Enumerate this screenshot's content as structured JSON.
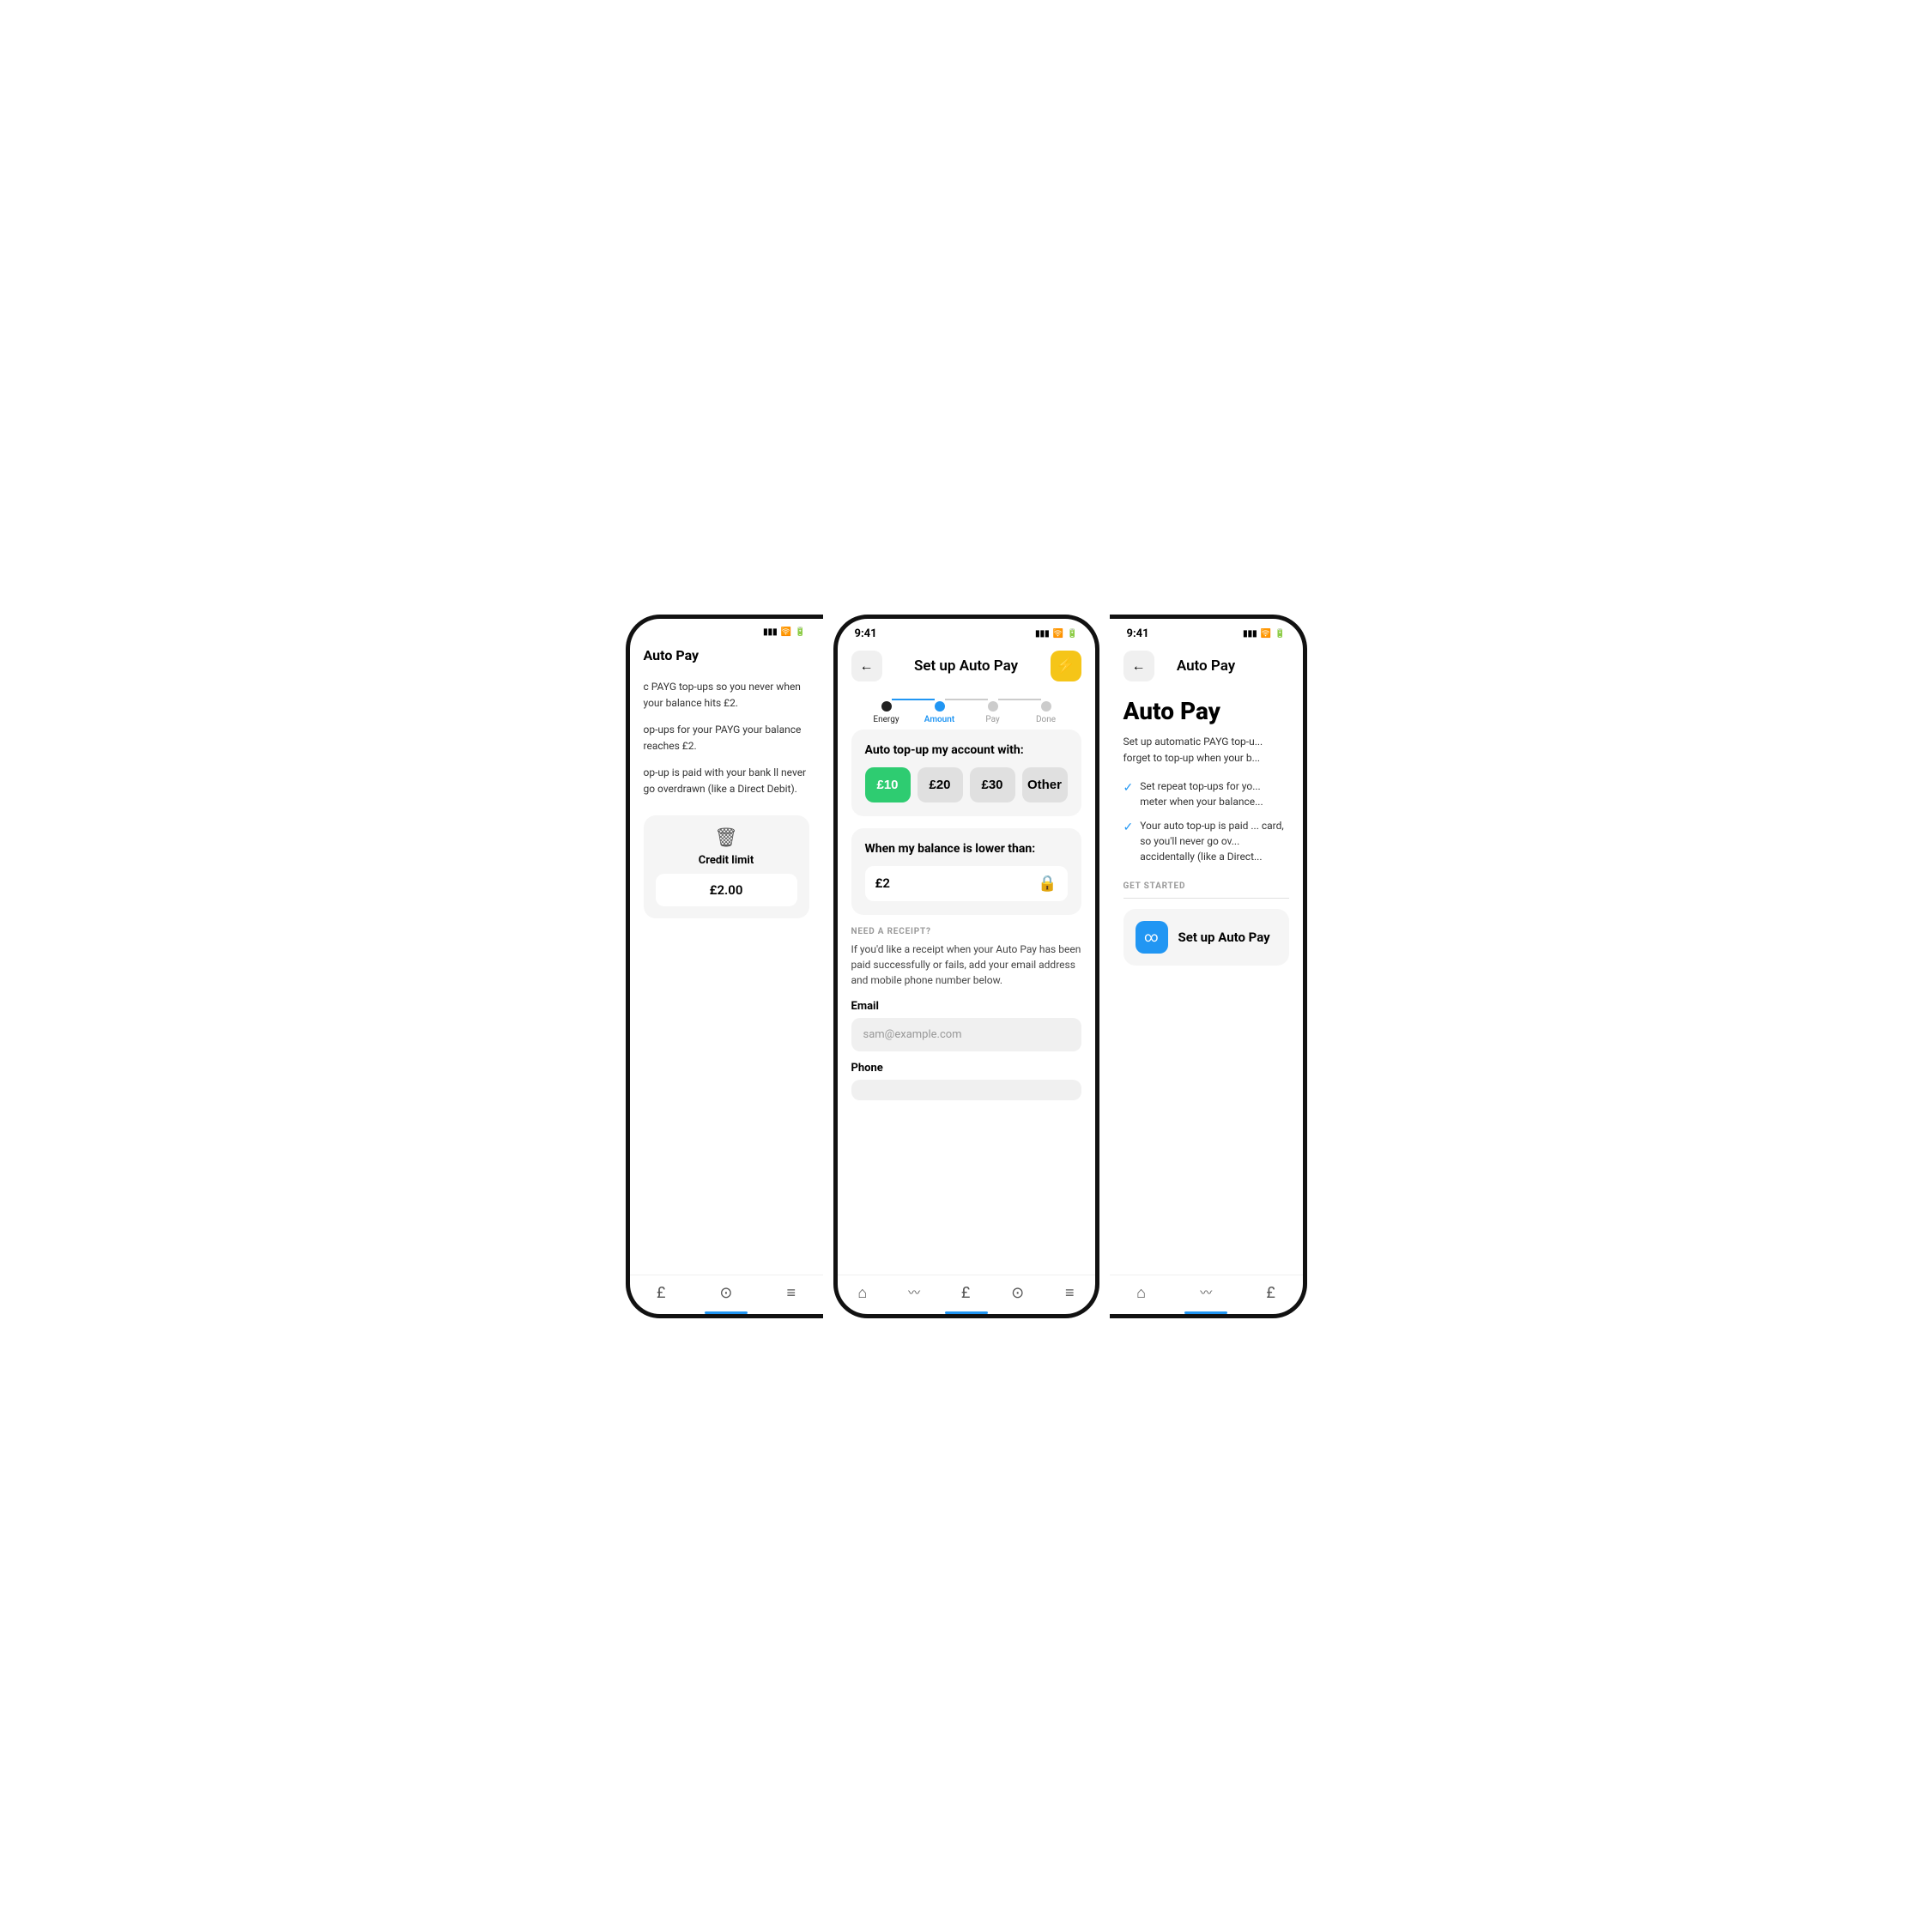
{
  "left_phone": {
    "title": "Auto Pay",
    "body1": "c PAYG top-ups so you never when your balance hits £2.",
    "body2": "op-ups for your PAYG your balance reaches £2.",
    "body3": "op-up is paid with your bank ll never go overdrawn (like a Direct Debit).",
    "credit_label": "Credit limit",
    "credit_value": "£2.00",
    "nav_items": [
      "£",
      "?",
      "≡"
    ]
  },
  "center_phone": {
    "status_time": "9:41",
    "back_label": "←",
    "title": "Set up Auto Pay",
    "lightning": "⚡",
    "stepper": {
      "steps": [
        "Energy",
        "Amount",
        "Pay",
        "Done"
      ],
      "active_index": 1
    },
    "top_up_section": {
      "title": "Auto top-up my account with:",
      "options": [
        {
          "label": "£10",
          "selected": true
        },
        {
          "label": "£20",
          "selected": false
        },
        {
          "label": "£30",
          "selected": false
        },
        {
          "label": "Other",
          "selected": false
        }
      ]
    },
    "balance_section": {
      "title": "When my balance is lower than:",
      "value": "£2",
      "lock_icon": "🔒"
    },
    "receipt_section": {
      "label": "NEED A RECEIPT?",
      "desc": "If you'd like a receipt when your Auto Pay has been paid successfully or fails, add your email address and mobile phone number below.",
      "email_label": "Email",
      "email_placeholder": "sam@example.com",
      "phone_label": "Phone"
    },
    "nav_items": [
      "🏠",
      "∿∿",
      "£",
      "?",
      "≡"
    ]
  },
  "right_phone": {
    "status_time": "9:41",
    "back_label": "←",
    "title": "Auto Pay",
    "hero_title": "Auto Pay",
    "desc": "Set up automatic PAYG top-u... forget to top-up when your b...",
    "checks": [
      "Set repeat top-ups for yo... meter when your balance...",
      "Your auto top-up is paid ... card, so you'll never go ov... accidentally (like a Direct..."
    ],
    "get_started_label": "GET STARTED",
    "setup_btn_label": "Set up Auto Pay",
    "setup_btn_icon": "∞",
    "nav_items": [
      "🏠",
      "∿∿",
      "£"
    ]
  }
}
